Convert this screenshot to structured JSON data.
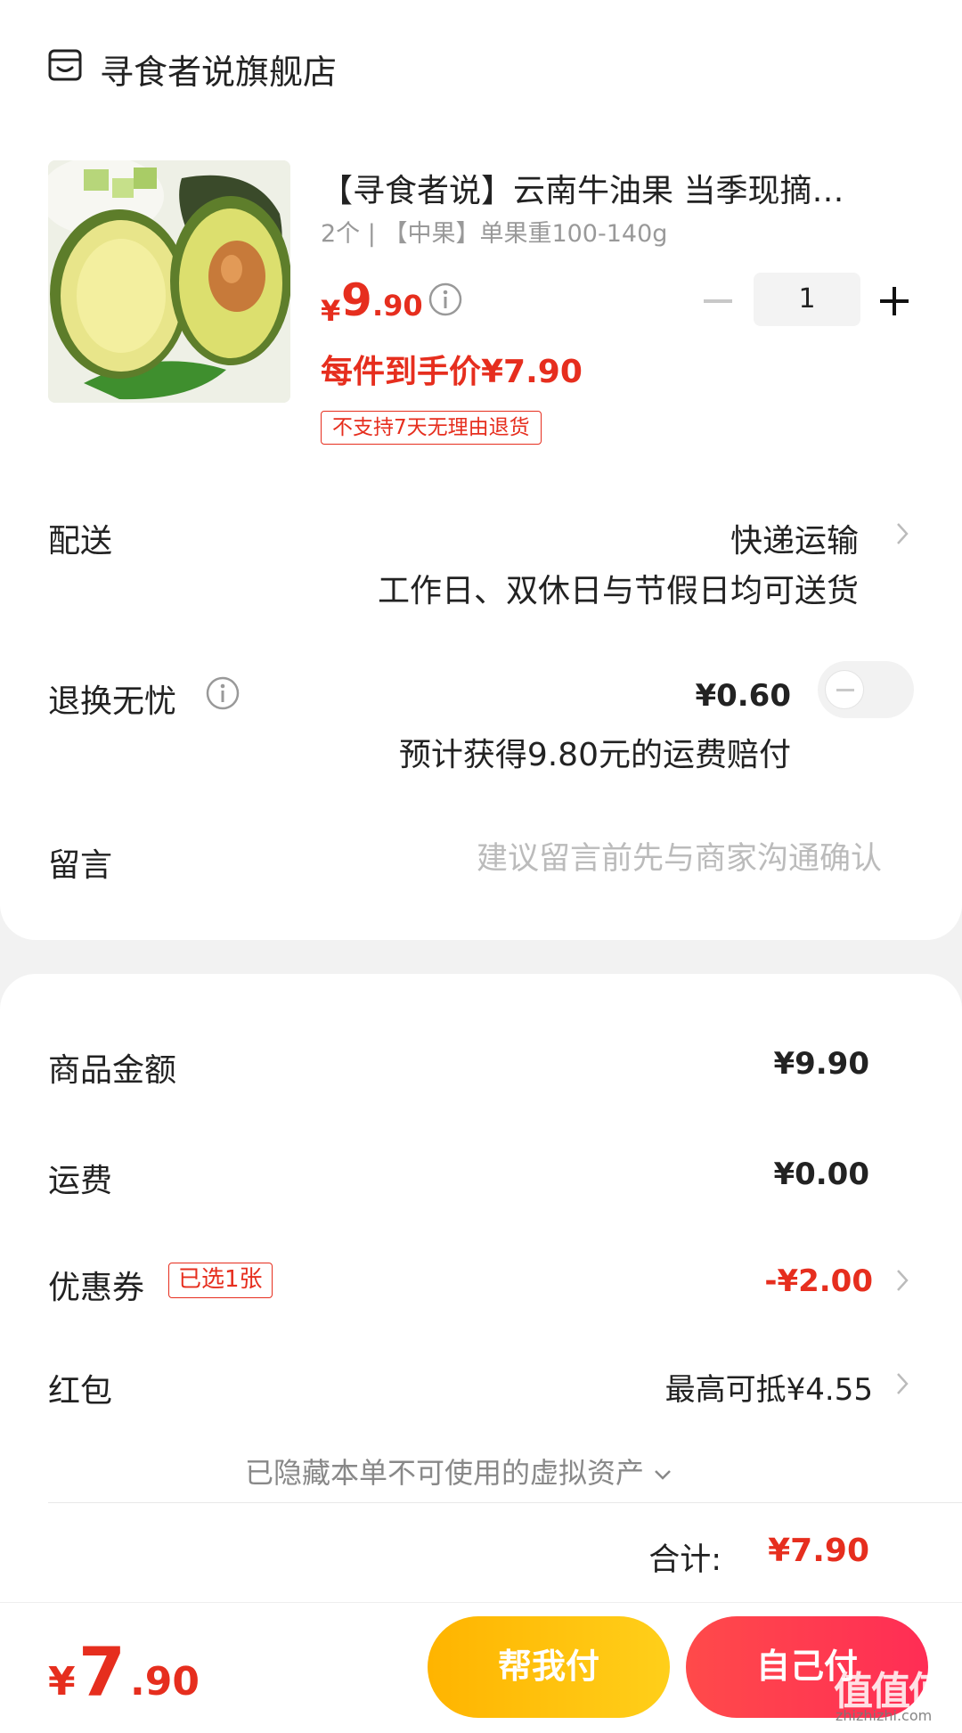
{
  "store": {
    "name": "寻食者说旗舰店",
    "icon": "store-icon"
  },
  "product": {
    "title": "【寻食者说】云南牛油果 当季现摘…",
    "spec": "2个 | 【中果】单果重100-140g",
    "price_symbol": "¥",
    "price_int": "9",
    "price_dec": ".90",
    "final_price": "每件到手价¥7.90",
    "return_tag": "不支持7天无理由退货",
    "quantity": "1",
    "image": "avocado-photo"
  },
  "delivery": {
    "label": "配送",
    "value": "快递运输",
    "sub": "工作日、双休日与节假日均可送货"
  },
  "insurance": {
    "label": "退换无忧",
    "price": "¥0.60",
    "sub": "预计获得9.80元的运费赔付",
    "enabled": false
  },
  "message": {
    "label": "留言",
    "placeholder": "建议留言前先与商家沟通确认"
  },
  "summary": {
    "amount_label": "商品金额",
    "amount_value": "¥9.90",
    "shipping_label": "运费",
    "shipping_value": "¥0.00",
    "coupon_label": "优惠券",
    "coupon_tag": "已选1张",
    "coupon_value": "-¥2.00",
    "hongbao_label": "红包",
    "hongbao_value": "最高可抵¥4.55",
    "hidden_assets": "已隐藏本单不可使用的虚拟资产",
    "total_label": "合计:",
    "total_value": "¥7.90"
  },
  "bottom": {
    "price_symbol": "¥",
    "price_int": "7",
    "price_dec": ".90",
    "help_pay": "帮我付",
    "self_pay": "自己付"
  },
  "watermark": {
    "text": "值值值",
    "url": "zhizhizhi.com"
  },
  "colors": {
    "accent_red": "#e62e1e",
    "pay_yellow": "#ffb400",
    "pay_red": "#ff3b4f"
  }
}
